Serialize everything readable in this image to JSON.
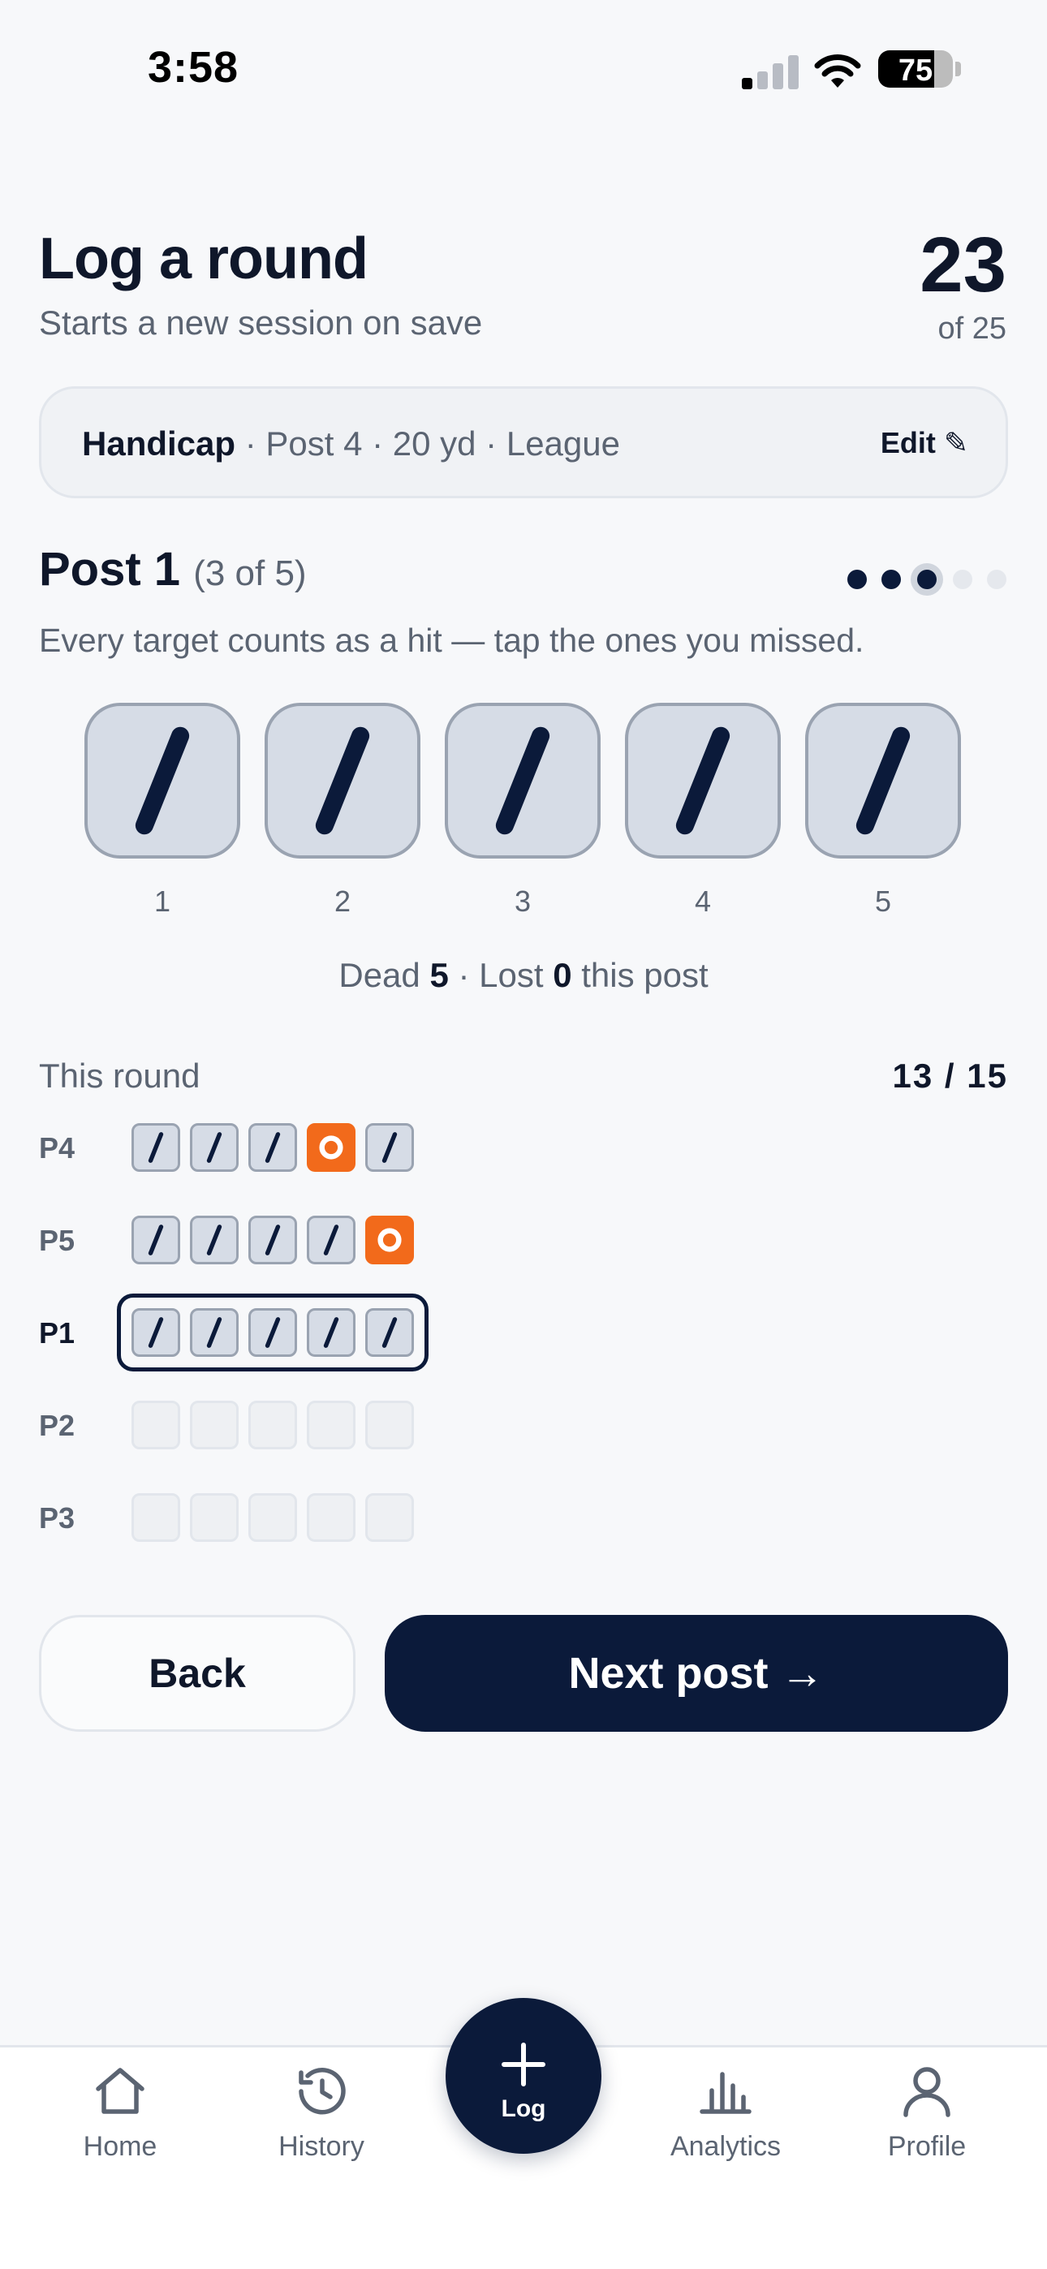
{
  "status_bar": {
    "time": "3:58",
    "battery": "75",
    "battery_level": 0.75
  },
  "header": {
    "title": "Log a round",
    "subtitle": "Starts a new session on save",
    "score": "23",
    "score_total": "of 25"
  },
  "event": {
    "discipline": "Handicap",
    "details": " · Post 4 · 20 yd · League",
    "edit_label": "Edit ✎"
  },
  "post": {
    "title": "Post 1",
    "count": "(3 of 5)",
    "hint": "Every target counts as a hit — tap the ones you missed.",
    "progress_current": 3,
    "progress_total": 5,
    "targets": [
      {
        "number": "1",
        "state": "hit"
      },
      {
        "number": "2",
        "state": "hit"
      },
      {
        "number": "3",
        "state": "hit"
      },
      {
        "number": "4",
        "state": "hit"
      },
      {
        "number": "5",
        "state": "hit"
      }
    ],
    "summary": {
      "dead_label": "Dead ",
      "dead_value": "5",
      "lost_label": " · Lost ",
      "lost_value": "0",
      "suffix": " this post"
    }
  },
  "round": {
    "label": "This round",
    "score": "13 / 15",
    "rows": [
      {
        "label": "P4",
        "states": [
          "hit",
          "hit",
          "hit",
          "miss",
          "hit"
        ],
        "current": false
      },
      {
        "label": "P5",
        "states": [
          "hit",
          "hit",
          "hit",
          "hit",
          "miss"
        ],
        "current": false
      },
      {
        "label": "P1",
        "states": [
          "hit",
          "hit",
          "hit",
          "hit",
          "hit"
        ],
        "current": true
      },
      {
        "label": "P2",
        "states": [
          "empty",
          "empty",
          "empty",
          "empty",
          "empty"
        ],
        "current": false
      },
      {
        "label": "P3",
        "states": [
          "empty",
          "empty",
          "empty",
          "empty",
          "empty"
        ],
        "current": false
      }
    ]
  },
  "actions": {
    "back_label": "Back",
    "next_label": "Next post →"
  },
  "tab_bar": {
    "items": [
      {
        "label": "Home",
        "icon": "home-icon"
      },
      {
        "label": "History",
        "icon": "history-icon"
      },
      {
        "label": "Log",
        "icon": "plus-icon"
      },
      {
        "label": "Analytics",
        "icon": "analytics-icon"
      },
      {
        "label": "Profile",
        "icon": "profile-icon"
      }
    ]
  },
  "colors": {
    "navy": "#0b1a3a",
    "miss_orange": "#f26a1b",
    "hit_fill": "#d6dce6",
    "muted_text": "#5b6472"
  }
}
